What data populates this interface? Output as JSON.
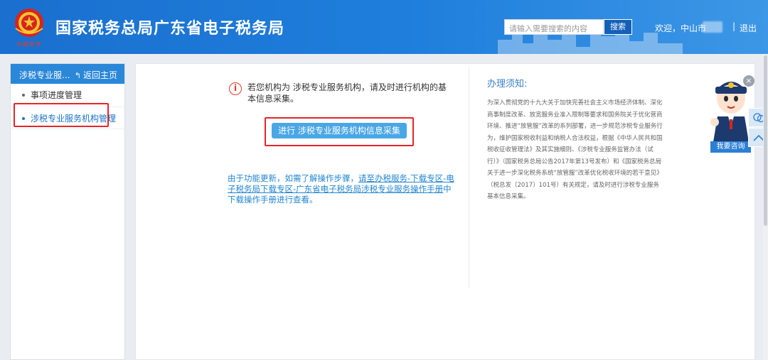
{
  "header": {
    "title": "国家税务总局广东省电子税务局",
    "emblem_caption": "中国税务",
    "search_placeholder": "请输入需要搜索的内容",
    "search_label": "搜索",
    "welcome": "欢迎，中山市",
    "separator": "|",
    "logout_label": "退出"
  },
  "sidebar": {
    "title": "涉税专业服...",
    "back_label": "返回主页",
    "items": [
      {
        "label": "事项进度管理"
      },
      {
        "label": "涉税专业服务机构管理"
      }
    ]
  },
  "main": {
    "notice": "若您机构为 涉税专业服务机构，请及时进行机构的基本信息采集。",
    "primary_button": "进行 涉税专业服务机构信息采集",
    "tip_prefix": "由于功能更新，如需了解操作步骤，",
    "tip_link": "请至办税服务-下载专区-电子税务局下载专区-广东省电子税务局涉税专业服务操作手册",
    "tip_suffix": "中下载操作手册进行查看。"
  },
  "panel": {
    "title": "办理须知:",
    "body": "为深入贯彻党的十九大关于加快完善社会主义市场经济体制、深化商事制度改革、放宽服务业准入限制等要求和国务院关于优化营商环境、推进“放管服”改革的系列部署，进一步规范涉税专业服务行为，维护国家税收利益和纳税人合法权益，根据《中华人民共和国税收征收管理法》及其实施细则、《涉税专业服务监管办法（试行）》（国家税务总局公告2017年第13号发布）和《国家税务总局关于进一步深化税务系统“放管服”改革优化税收环境的若干意见》（税总发〔2017〕101号）有关规定，请及时进行涉税专业服务基本信息采集。"
  },
  "assistant": {
    "consult_label": "我要咨询"
  },
  "colors": {
    "header_blue": "#1f7fdc",
    "sidebar_head": "#2b87d8",
    "link_blue": "#2386d0",
    "highlight_red": "#e5252a",
    "button_blue": "#4aa7e6"
  }
}
